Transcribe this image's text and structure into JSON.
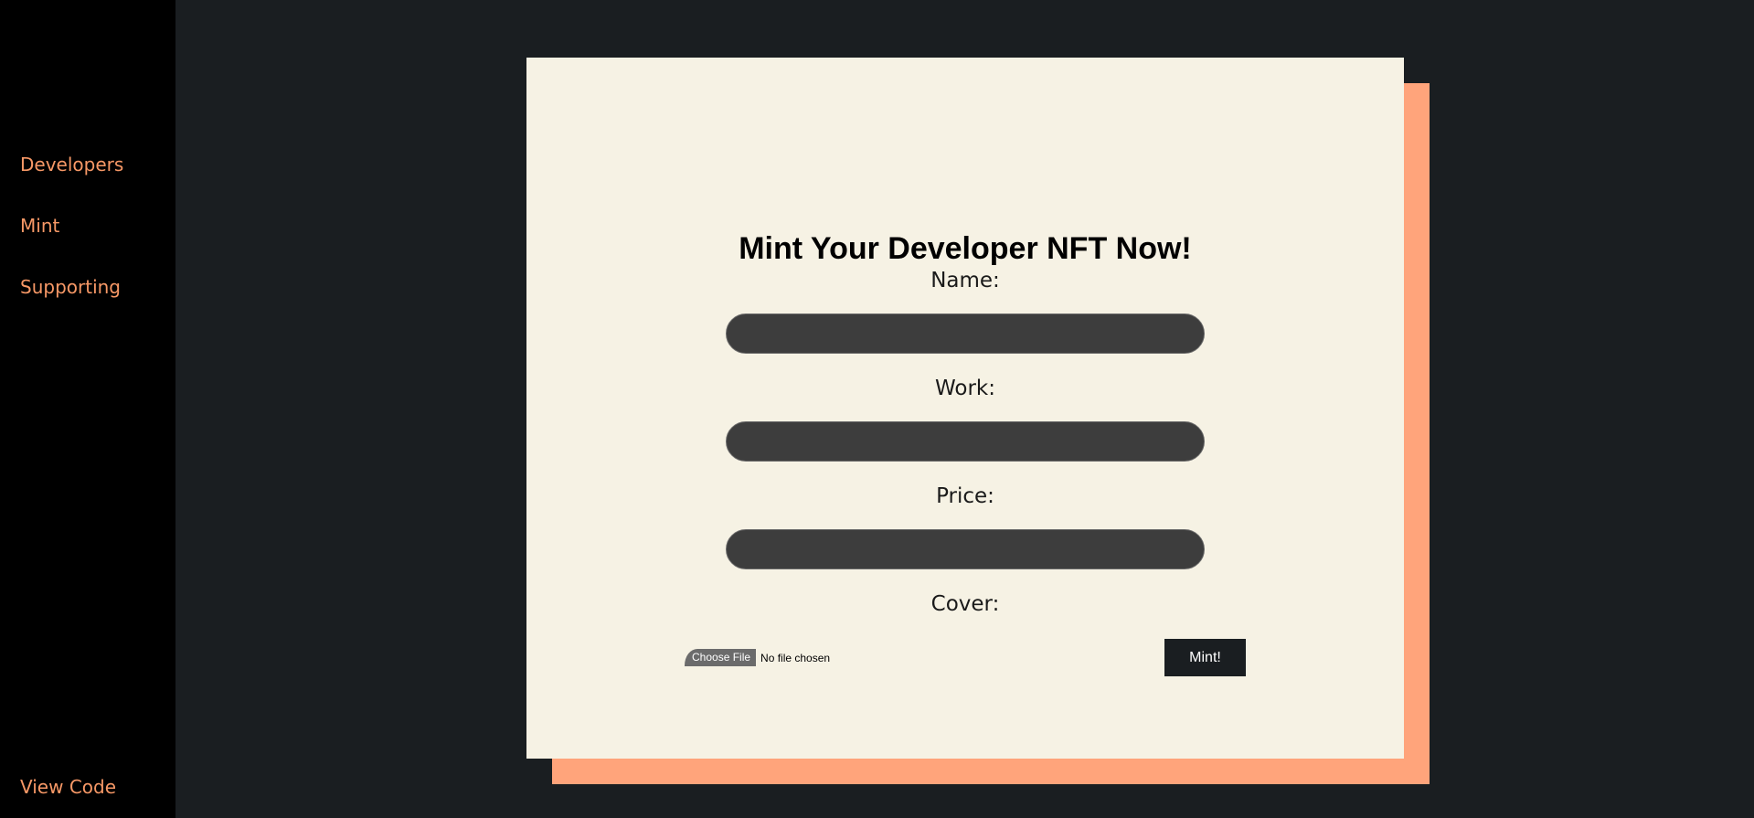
{
  "sidebar": {
    "items": [
      {
        "label": "Developers"
      },
      {
        "label": "Mint"
      },
      {
        "label": "Supporting"
      }
    ],
    "footer_link": "View Code"
  },
  "form": {
    "title": "Mint Your Developer NFT Now!",
    "fields": {
      "name_label": "Name:",
      "work_label": "Work:",
      "price_label": "Price:",
      "cover_label": "Cover:"
    },
    "file_button": "Choose File",
    "file_status": "No file chosen",
    "submit_label": "Mint!"
  },
  "colors": {
    "accent": "#f79866",
    "card_bg": "#f6f2e4",
    "card_shadow": "#ffa47b",
    "page_bg": "#1a1e21",
    "sidebar_bg": "#000000",
    "input_bg": "#3d3d3d"
  }
}
